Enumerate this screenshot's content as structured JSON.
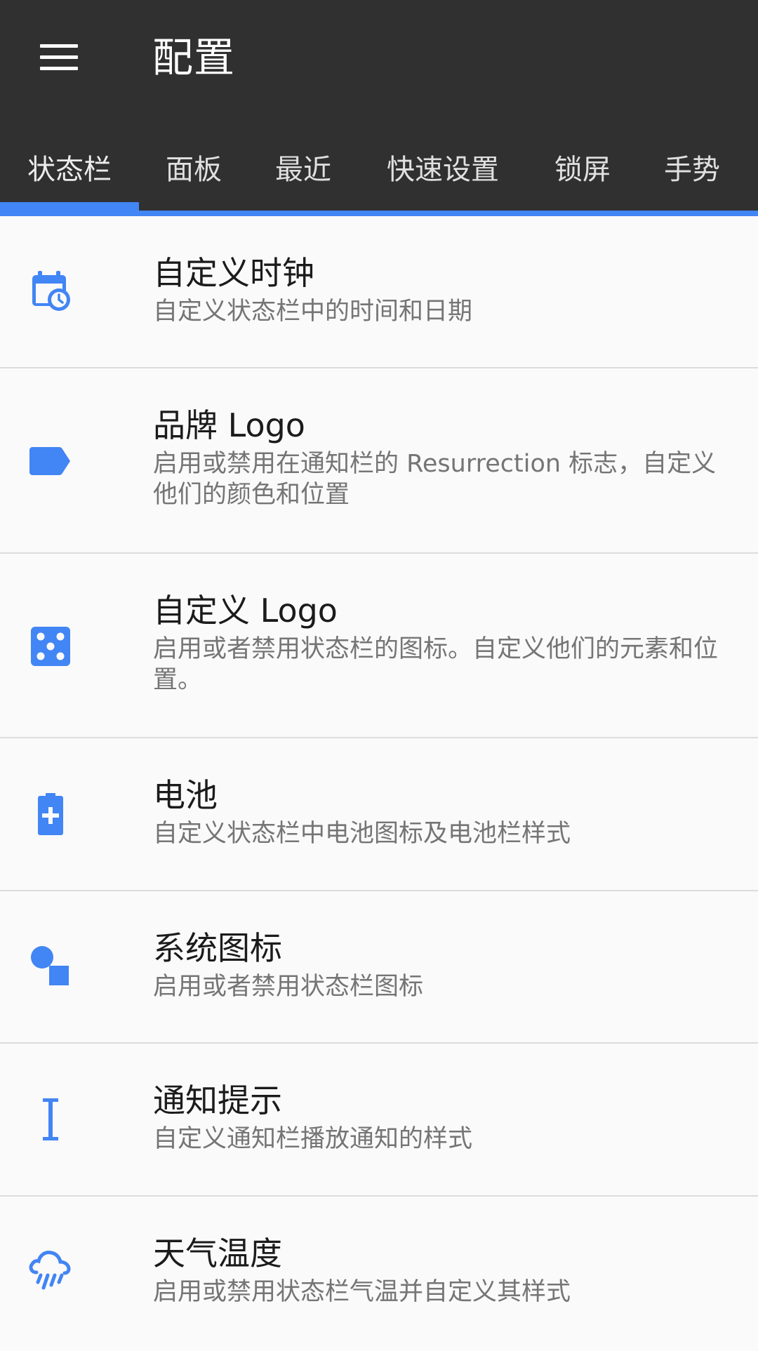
{
  "app_bar": {
    "title": "配置",
    "menu_icon": "menu-icon"
  },
  "tabs": [
    {
      "label": "状态栏",
      "active": true
    },
    {
      "label": "面板",
      "active": false
    },
    {
      "label": "最近",
      "active": false
    },
    {
      "label": "快速设置",
      "active": false
    },
    {
      "label": "锁屏",
      "active": false
    },
    {
      "label": "手势",
      "active": false
    }
  ],
  "items": [
    {
      "title": "自定义时钟",
      "subtitle": "自定义状态栏中的时间和日期",
      "icon": "calendar-clock-icon"
    },
    {
      "title": "品牌 Logo",
      "subtitle": "启用或禁用在通知栏的 Resurrection 标志，自定义他们的颜色和位置",
      "icon": "label-icon"
    },
    {
      "title": "自定义 Logo",
      "subtitle": "启用或者禁用状态栏的图标。自定义他们的元素和位置。",
      "icon": "dice-icon"
    },
    {
      "title": "电池",
      "subtitle": "自定义状态栏中电池图标及电池栏样式",
      "icon": "battery-plus-icon"
    },
    {
      "title": "系统图标",
      "subtitle": "启用或者禁用状态栏图标",
      "icon": "shapes-icon"
    },
    {
      "title": "通知提示",
      "subtitle": "自定义通知栏播放通知的样式",
      "icon": "text-cursor-icon"
    },
    {
      "title": "天气温度",
      "subtitle": "启用或禁用状态栏气温并自定义其样式",
      "icon": "weather-rain-icon"
    }
  ],
  "colors": {
    "toolbar": "#303030",
    "accent": "#4285f4",
    "background": "#fafafa",
    "title_text": "#1b1b1b",
    "subtitle_text": "#757575"
  }
}
